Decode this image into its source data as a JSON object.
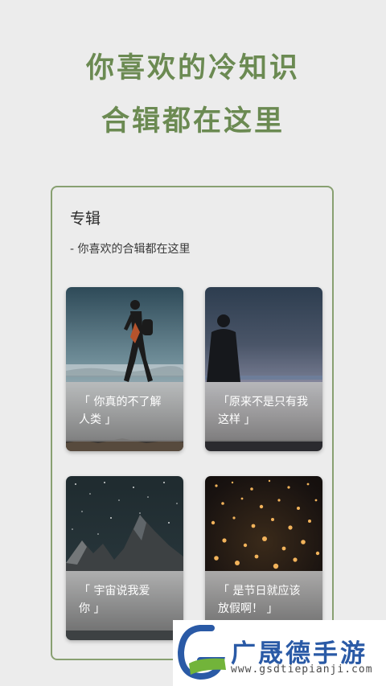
{
  "hero": {
    "line1": "你喜欢的冷知识",
    "line2": "合辑都在这里"
  },
  "album": {
    "title": "专辑",
    "subtitle": "- 你喜欢的合辑都在这里",
    "cards": [
      {
        "caption_line1": "「 你真的不了解",
        "caption_line2": "人类 」"
      },
      {
        "caption_line1": "「原来不是只有我",
        "caption_line2": "这样 」"
      },
      {
        "caption_line1": "「 宇宙说我爱",
        "caption_line2": "你 」"
      },
      {
        "caption_line1": "「 是节日就应该",
        "caption_line2": "放假啊！ 」"
      }
    ]
  },
  "watermark": {
    "name": "广晟德手游",
    "url": "www.gsdtiepianji.com"
  },
  "colors": {
    "accent_green": "#6b8a52",
    "frame_border": "#88a071",
    "background": "#ececec",
    "watermark_blue": "#2a5aa6"
  }
}
